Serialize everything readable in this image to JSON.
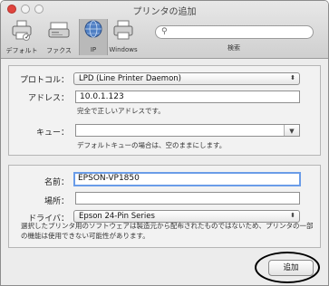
{
  "window": {
    "title": "プリンタの追加"
  },
  "toolbar": {
    "items": [
      {
        "label": "デフォルト"
      },
      {
        "label": "ファクス"
      },
      {
        "label": "IP"
      },
      {
        "label": "Windows"
      }
    ],
    "search_label": "検索",
    "search_placeholder": ""
  },
  "form": {
    "protocol": {
      "label": "プロトコル：",
      "value": "LPD (Line Printer Daemon)"
    },
    "address": {
      "label": "アドレス：",
      "value": "10.0.1.123",
      "hint": "完全で正しいアドレスです。"
    },
    "queue": {
      "label": "キュー：",
      "value": "",
      "hint": "デフォルトキューの場合は、空のままにします。"
    },
    "name": {
      "label": "名前：",
      "value": "EPSON-VP1850"
    },
    "location": {
      "label": "場所：",
      "value": ""
    },
    "driver": {
      "label": "ドライバ：",
      "value": "Epson 24-Pin Series"
    },
    "note": "選択したプリンタ用のソフトウェアは製造元から配布されたものではないため、プリンタの一部の機能は使用できない可能性があります。"
  },
  "buttons": {
    "add": "追加"
  },
  "colors": {
    "close": "#e0443e",
    "focus": "#6a9ce8",
    "highlight": "#000000"
  }
}
